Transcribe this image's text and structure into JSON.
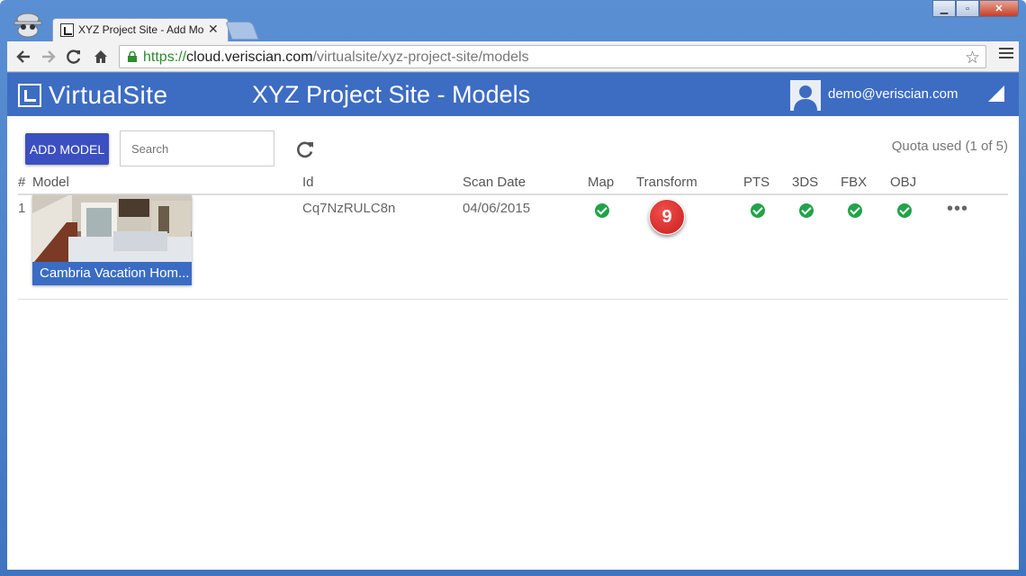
{
  "browser": {
    "tab_title": "XYZ Project Site - Add Mo",
    "tab_close": "✕",
    "url_scheme": "https://",
    "url_host": "cloud.veriscian.com",
    "url_path": "/virtualsite/xyz-project-site/models",
    "window_controls": {
      "minimize": "▁",
      "maximize": "▫",
      "close": "✕"
    }
  },
  "app": {
    "logo_text": "VirtualSite",
    "page_title": "XYZ Project Site - Models",
    "user_email": "demo@veriscian.com"
  },
  "controls": {
    "add_model_label": "ADD MODEL",
    "search_placeholder": "Search",
    "quota_text": "Quota used (1 of 5)"
  },
  "table": {
    "headers": {
      "index": "#",
      "model": "Model",
      "id": "Id",
      "scan_date": "Scan Date",
      "map": "Map",
      "transform": "Transform",
      "pts": "PTS",
      "3ds": "3DS",
      "fbx": "FBX",
      "obj": "OBJ"
    },
    "rows": [
      {
        "index": "1",
        "model_name": "Cambria Vacation Hom...",
        "id": "Cq7NzRULC8n",
        "scan_date": "04/06/2015",
        "map": true,
        "pts": true,
        "3ds": true,
        "fbx": true,
        "obj": true,
        "more": "•••"
      }
    ]
  },
  "callout_badge": "9",
  "colors": {
    "appbar": "#3d6cc3",
    "add_button": "#3c4fc0",
    "check": "#22a34a",
    "badge": "#d52a2a"
  }
}
